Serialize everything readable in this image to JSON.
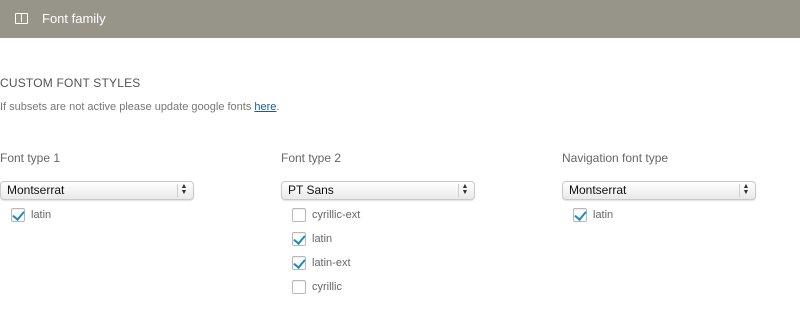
{
  "header": {
    "title": "Font family",
    "icon": "columns-icon",
    "bg_color": "#979589"
  },
  "section": {
    "title": "CUSTOM FONT STYLES",
    "info_text": "If subsets are not active please update google fonts ",
    "info_link": "here",
    "info_end": "."
  },
  "columns": [
    {
      "label": "Font type 1",
      "selected": "Montserrat",
      "subsets": [
        {
          "label": "latin",
          "checked": true
        }
      ]
    },
    {
      "label": "Font type 2",
      "selected": "PT Sans",
      "subsets": [
        {
          "label": "cyrillic-ext",
          "checked": false
        },
        {
          "label": "latin",
          "checked": true
        },
        {
          "label": "latin-ext",
          "checked": true
        },
        {
          "label": "cyrillic",
          "checked": false
        }
      ]
    },
    {
      "label": "Navigation font type",
      "selected": "Montserrat",
      "subsets": [
        {
          "label": "latin",
          "checked": true
        }
      ]
    }
  ],
  "colors": {
    "accent_check": "#1e8cbe",
    "link": "#1a5a96"
  }
}
